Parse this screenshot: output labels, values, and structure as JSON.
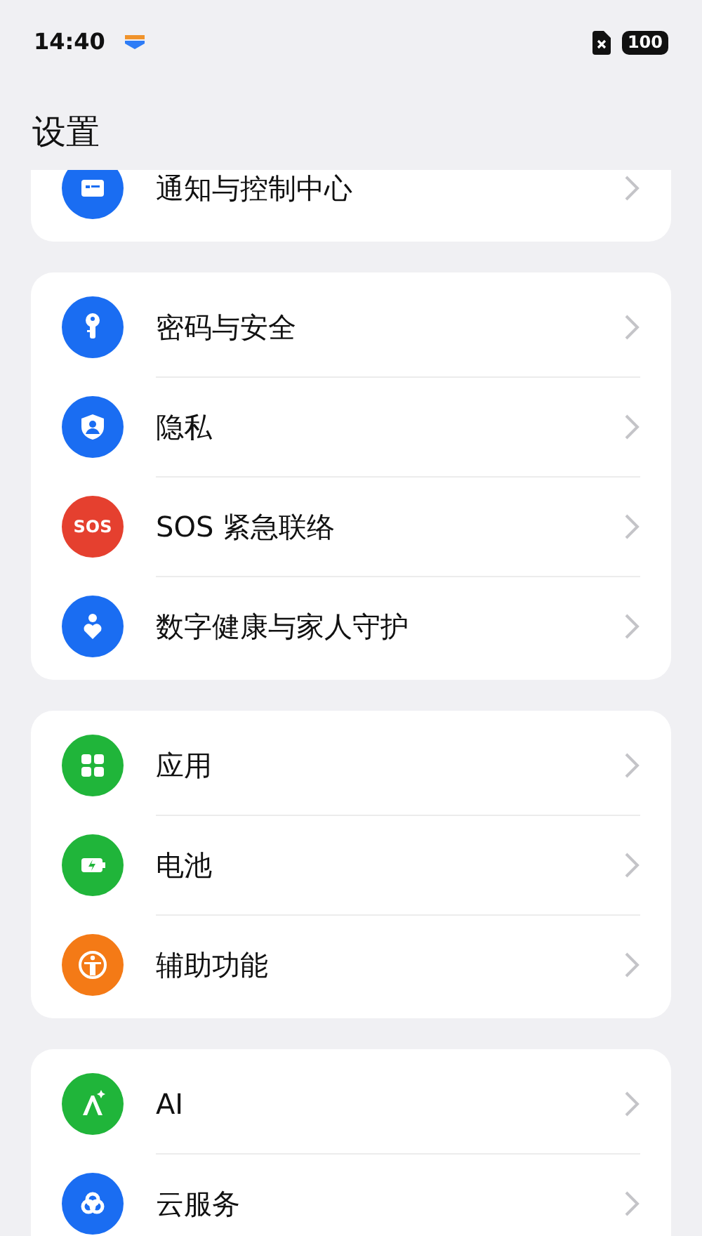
{
  "status_bar": {
    "time": "14:40",
    "battery": "100"
  },
  "title": "设置",
  "groups": [
    {
      "items": [
        {
          "label": "通知与控制中心",
          "color": "#1a6df2"
        }
      ]
    },
    {
      "items": [
        {
          "label": "密码与安全",
          "color": "#1a6df2"
        },
        {
          "label": "隐私",
          "color": "#1a6df2"
        },
        {
          "label": "SOS 紧急联络",
          "color": "#e5402f",
          "icon_text": "SOS"
        },
        {
          "label": "数字健康与家人守护",
          "color": "#1a6df2"
        }
      ]
    },
    {
      "items": [
        {
          "label": "应用",
          "color": "#20b53a"
        },
        {
          "label": "电池",
          "color": "#20b53a"
        },
        {
          "label": "辅助功能",
          "color": "#f47a16"
        }
      ]
    },
    {
      "items": [
        {
          "label": "AI",
          "color": "#20b53a"
        },
        {
          "label": "云服务",
          "color": "#1a6df2"
        }
      ]
    }
  ]
}
